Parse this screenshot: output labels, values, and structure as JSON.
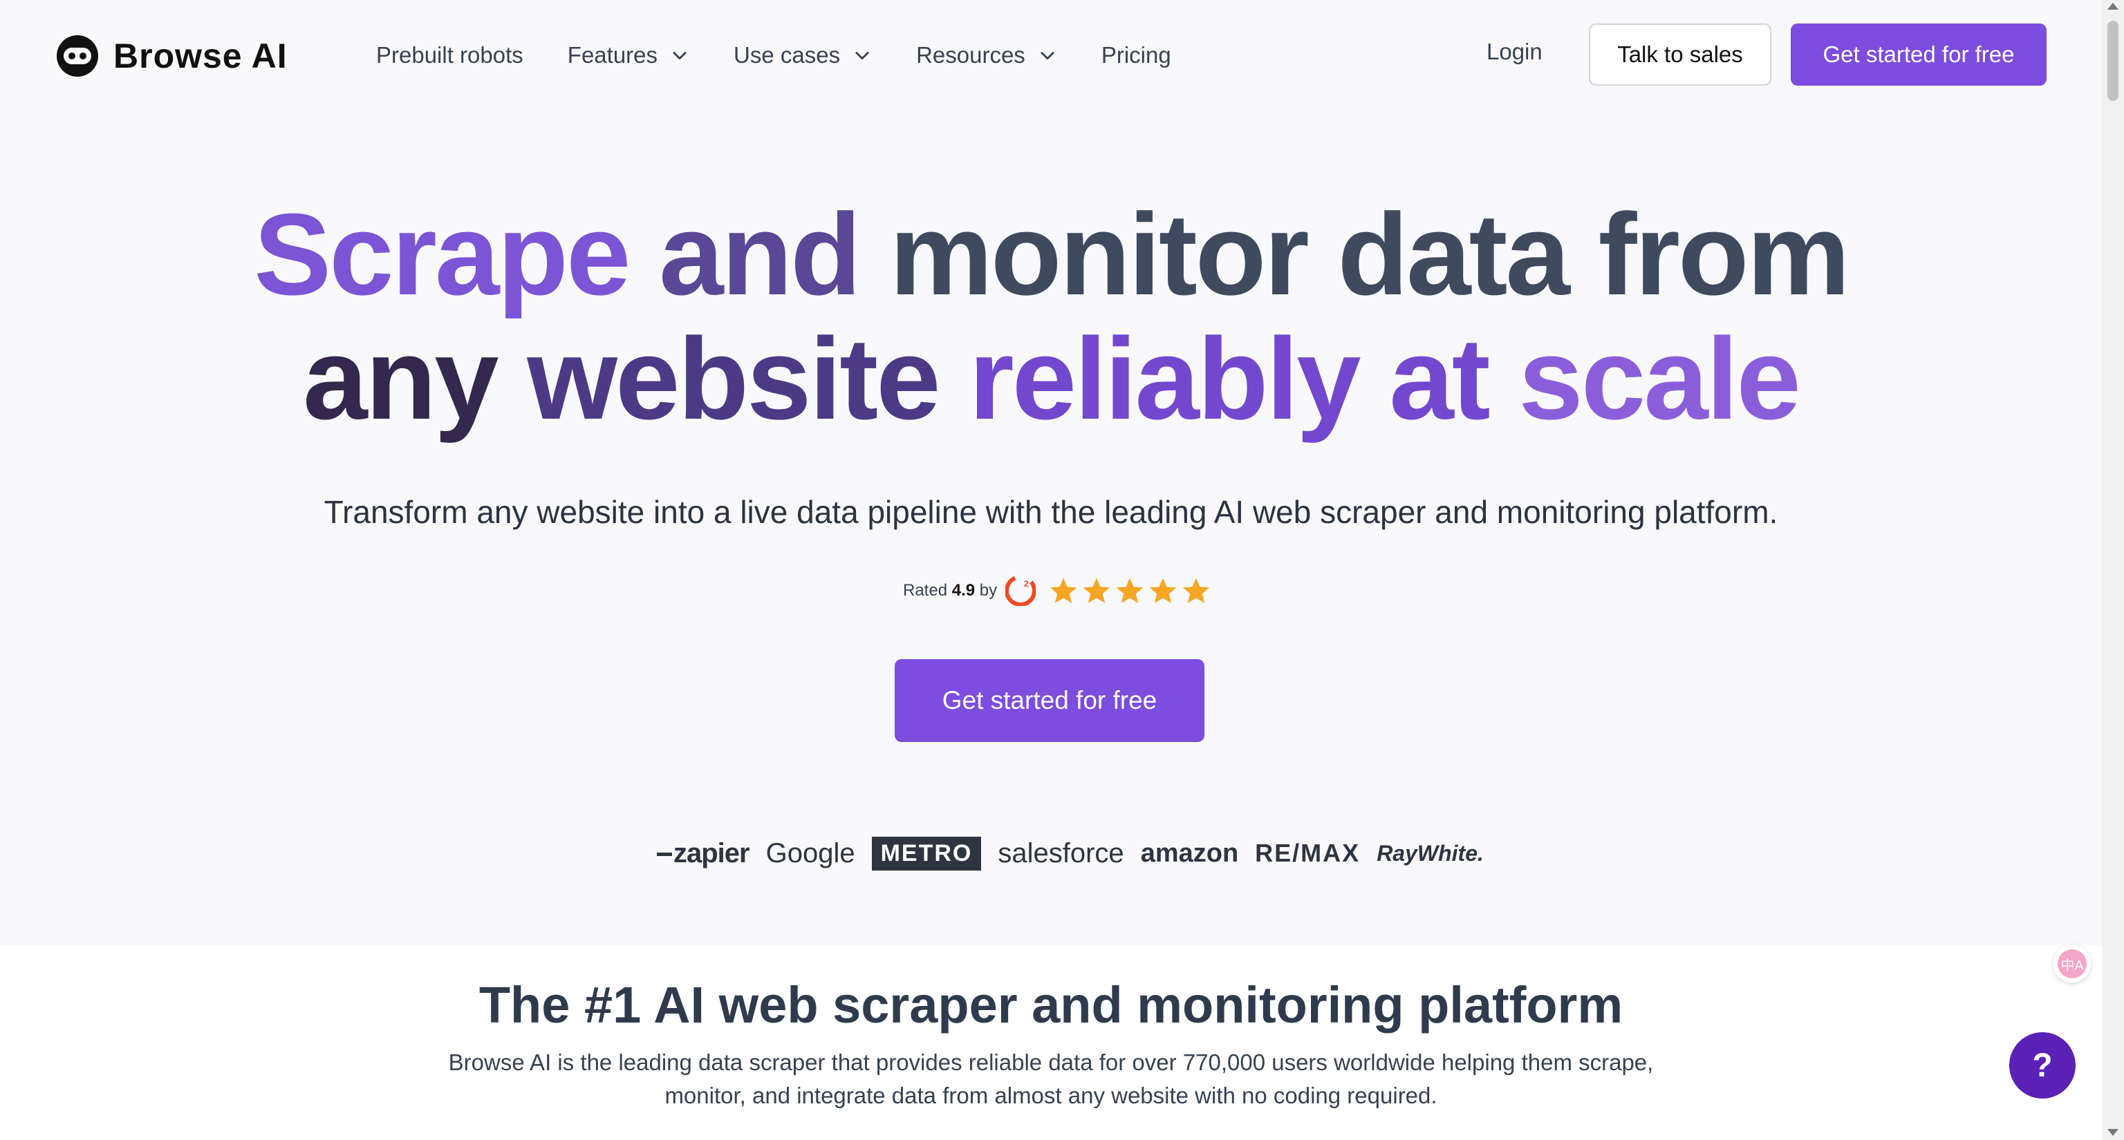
{
  "header": {
    "logo_text": "Browse AI",
    "menu": [
      {
        "label": "Prebuilt robots",
        "has_dropdown": false
      },
      {
        "label": "Features",
        "has_dropdown": true
      },
      {
        "label": "Use cases",
        "has_dropdown": true
      },
      {
        "label": "Resources",
        "has_dropdown": true
      },
      {
        "label": "Pricing",
        "has_dropdown": false
      }
    ],
    "login_label": "Login",
    "talk_to_sales_label": "Talk to sales",
    "get_started_label": "Get started for free"
  },
  "hero": {
    "title_line1": {
      "w1": "Scrape",
      "w2": "and",
      "w3": "monitor",
      "w4": "data",
      "w5": "from"
    },
    "title_line2": {
      "w1": "any",
      "w2": "website",
      "w3": "reliably",
      "w4": "at",
      "w5": "scale"
    },
    "subtitle": "Transform any website into a live data pipeline with the leading AI web scraper and monitoring platform.",
    "rating": {
      "prefix": "Rated",
      "value": "4.9",
      "suffix": "by",
      "stars": 5,
      "platform_icon": "g2-icon"
    },
    "cta_label": "Get started for free"
  },
  "customer_logos": {
    "zapier": "zapier",
    "google": "Google",
    "metro": "METRO",
    "salesforce": "salesforce",
    "amazon": "amazon",
    "remax": "RE/MAX",
    "raywhite": "RayWhite."
  },
  "section": {
    "title": "The #1 AI web scraper and monitoring platform",
    "body": "Browse AI is the leading data scraper that provides reliable data for over 770,000 users worldwide helping them scrape, monitor, and integrate data from almost any website with no coding required."
  },
  "widgets": {
    "help_label": "?",
    "translate_label": "中A"
  },
  "colors": {
    "primary": "#7c4ddf",
    "title_purple": "#7b55d6",
    "title_slate": "#3f4a5e",
    "star": "#f5a623",
    "help_fab": "#5b21b6"
  }
}
